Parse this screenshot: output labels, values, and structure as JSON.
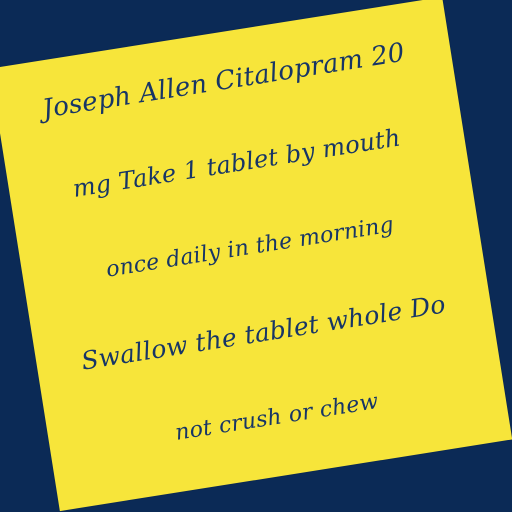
{
  "note": {
    "lines": [
      "Joseph Allen Citalopram 20",
      "mg Take 1 tablet by mouth",
      "once daily in the morning",
      "Swallow the tablet whole Do",
      "not crush or chew"
    ]
  },
  "colors": {
    "background": "#0b2a56",
    "paper": "#f7e53a",
    "ink": "#173566"
  }
}
